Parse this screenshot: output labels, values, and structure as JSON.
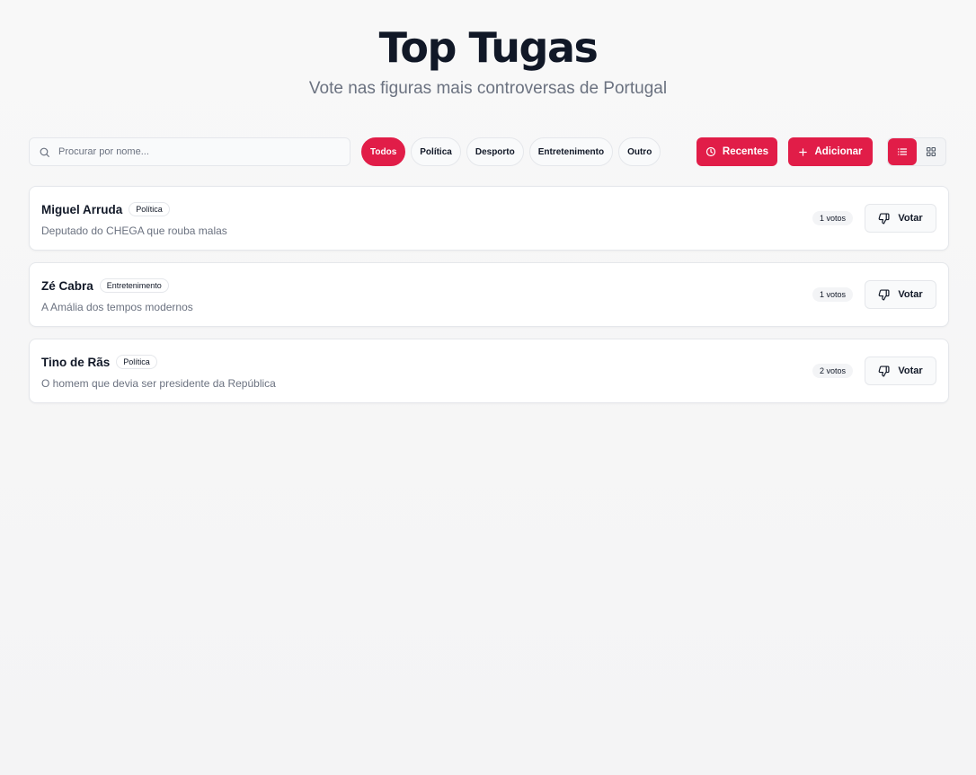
{
  "header": {
    "title": "Top Tugas",
    "subtitle": "Vote nas figuras mais controversas de Portugal"
  },
  "search": {
    "placeholder": "Procurar por nome..."
  },
  "filters": [
    "Todos",
    "Política",
    "Desporto",
    "Entretenimento",
    "Outro"
  ],
  "active_filter": "Todos",
  "actions": {
    "recent_label": "Recentes",
    "add_label": "Adicionar"
  },
  "view_mode": "list",
  "colors": {
    "accent": "#e11d48"
  },
  "items": [
    {
      "name": "Miguel Arruda",
      "category": "Política",
      "description": "Deputado do CHEGA que rouba malas",
      "votes": "1 votos",
      "vote_label": "Votar"
    },
    {
      "name": "Zé Cabra",
      "category": "Entretenimento",
      "description": "A Amália dos tempos modernos",
      "votes": "1 votos",
      "vote_label": "Votar"
    },
    {
      "name": "Tino de Rãs",
      "category": "Política",
      "description": "O homem que devia ser presidente da República",
      "votes": "2 votos",
      "vote_label": "Votar"
    }
  ]
}
